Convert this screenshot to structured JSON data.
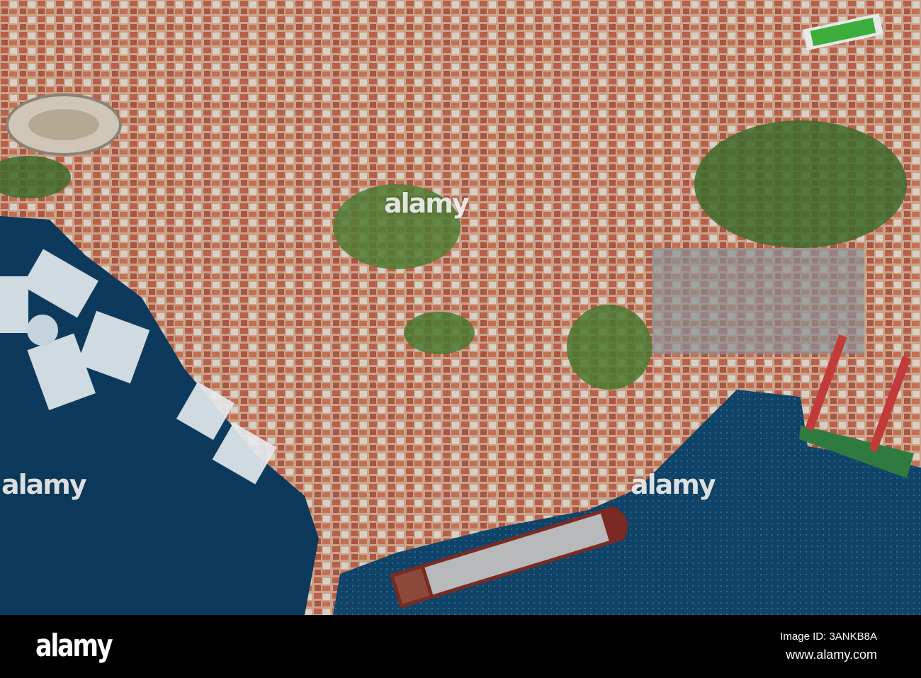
{
  "image": {
    "subject": "aerial-harbor-city",
    "watermark": "alamy",
    "colors": {
      "water": "#0d3a5c",
      "roofs": "#b8664a",
      "greenery": "#3f6e2c",
      "footer": "#000000"
    }
  },
  "watermarks": [
    "alamy",
    "alamy",
    "alamy"
  ],
  "footer": {
    "logo": "alamy",
    "image_id": "Image ID: 3ANKB8A",
    "url": "www.alamy.com"
  }
}
